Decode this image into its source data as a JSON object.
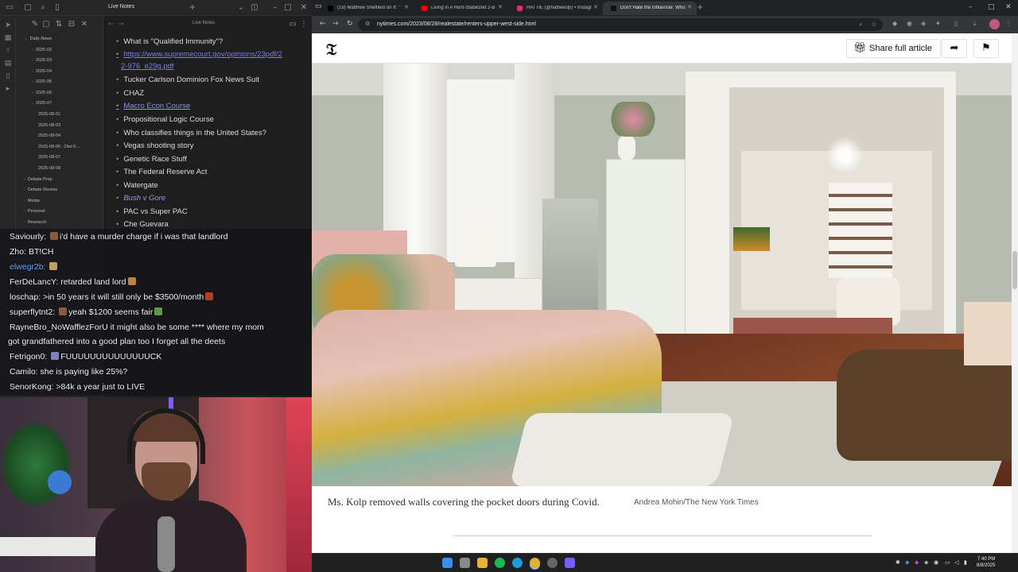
{
  "notes": {
    "window_title": "Live Notes",
    "header_title": "Live Notes",
    "tree": [
      {
        "label": "Daily News",
        "level": 0,
        "open": true
      },
      {
        "label": "2025-02",
        "level": 1
      },
      {
        "label": "2025-03",
        "level": 1
      },
      {
        "label": "2025-04",
        "level": 1
      },
      {
        "label": "2025-05",
        "level": 1
      },
      {
        "label": "2025-06",
        "level": 1
      },
      {
        "label": "2025-07",
        "level": 1
      },
      {
        "label": "2025-08-01",
        "level": 2
      },
      {
        "label": "2025-08-03",
        "level": 2
      },
      {
        "label": "2025-08-04",
        "level": 2
      },
      {
        "label": "2025-08-06 - Diet F...",
        "level": 2
      },
      {
        "label": "2025-08-07",
        "level": 2
      },
      {
        "label": "2025-08-08",
        "level": 2
      },
      {
        "label": "Debate Prep",
        "level": 0
      },
      {
        "label": "Debate Review",
        "level": 0
      },
      {
        "label": "Media",
        "level": 0
      },
      {
        "label": "Personal",
        "level": 0
      },
      {
        "label": "Research",
        "level": 0
      }
    ],
    "bullets": [
      {
        "text": "What is \"Qualified Immunity\"?",
        "style": "normal"
      },
      {
        "text": "https://www.supremecourt.gov/opinions/23pdf/2",
        "style": "link"
      },
      {
        "text": "2-976_e29g.pdf",
        "style": "link-cont"
      },
      {
        "text": "Tucker Carlson Dominion Fox News Suit",
        "style": "normal"
      },
      {
        "text": "CHAZ",
        "style": "normal"
      },
      {
        "text": "Macro Econ Course",
        "style": "plainlink"
      },
      {
        "text": "Propositional Logic Course",
        "style": "normal"
      },
      {
        "text": "Who classifies things in the United States?",
        "style": "normal"
      },
      {
        "text": "Vegas shooting story",
        "style": "normal"
      },
      {
        "text": "Genetic Race Stuff",
        "style": "normal"
      },
      {
        "text": "The Federal Reserve Act",
        "style": "normal"
      },
      {
        "text": "Watergate",
        "style": "normal"
      },
      {
        "text": "Bush v Gore",
        "style": "italic"
      },
      {
        "text": "PAC vs Super PAC",
        "style": "normal"
      },
      {
        "text": "Che Guevara",
        "style": "normal"
      }
    ]
  },
  "chat": [
    {
      "user": "Saviourly:",
      "msg": "i'd have a murder charge if i was that landlord",
      "blue": false
    },
    {
      "user": "Zho:",
      "msg": "BT!CH",
      "blue": false
    },
    {
      "user": "elwegr2b:",
      "msg": "",
      "blue": true
    },
    {
      "user": "FerDeLancY:",
      "msg": "retarded land lord",
      "blue": false
    },
    {
      "user": "loschap:",
      "msg": ">in 50 years it will still only be $3500/month",
      "blue": false
    },
    {
      "user": "superflytnt2:",
      "msg": "yeah $1200 seems fair",
      "blue": false
    },
    {
      "user": "RayneBro_NoWafflezForU",
      "msg": "it might also be some **** where my mom",
      "blue": false
    },
    {
      "user": "",
      "msg": "got grandfathered into a good plan too I forget all the deets",
      "blue": false
    },
    {
      "user": "Fetrigon0:",
      "msg": "FUUUUUUUUUUUUUUCK",
      "blue": false
    },
    {
      "user": "Camilo:",
      "msg": "she is paying like 25%?",
      "blue": false
    },
    {
      "user": "SenorKong:",
      "msg": ">84k a year just to LIVE",
      "blue": false
    }
  ],
  "browser": {
    "tabs": [
      {
        "title": "(19) Matthew Sheffield on X: \"",
        "favicon_color": "#000000",
        "active": false
      },
      {
        "title": "Living in A Rent-Stabilized 2-B",
        "favicon_color": "#ff0000",
        "active": false
      },
      {
        "title": "HATTIE (@hattiekolp) • Instagr",
        "favicon_color": "#e1306c",
        "active": false
      },
      {
        "title": "Don't Hate the Influencer. Who",
        "favicon_color": "#111111",
        "active": true
      }
    ],
    "url": "nytimes.com/2023/08/28/realestate/renters-upper-west-side.html",
    "share_label": "Share full article",
    "caption": "Ms. Kolp removed walls covering the pocket doors during Covid.",
    "credit": "Andrea Mohin/The New York Times"
  },
  "taskbar": {
    "time": "7:40 PM",
    "date": "8/8/2025"
  }
}
